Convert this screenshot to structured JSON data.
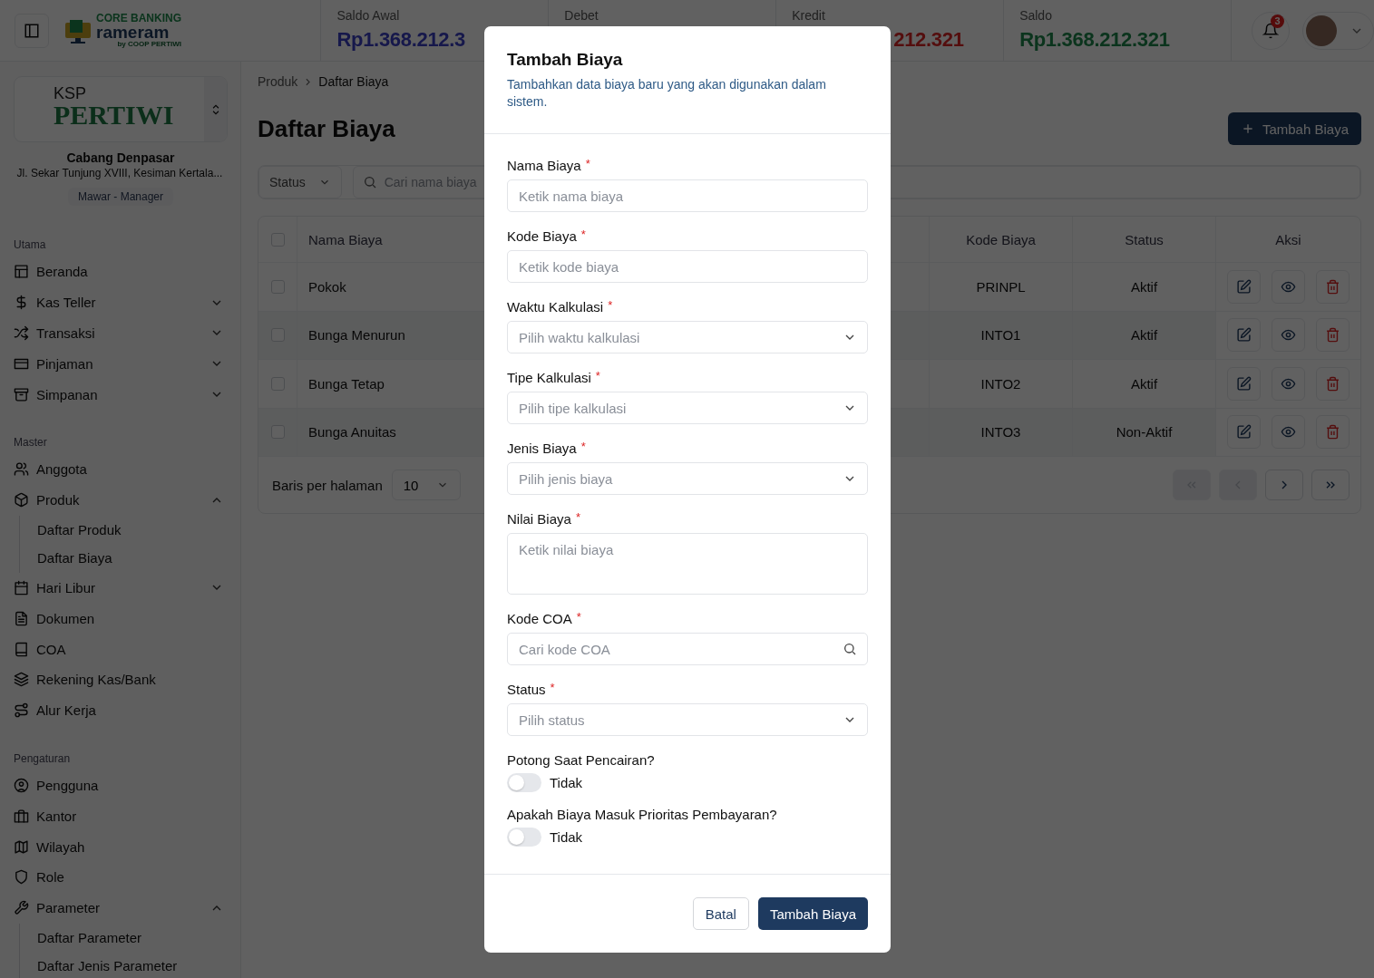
{
  "header": {
    "logo": {
      "line1": "CORE BANKING",
      "line2": "rameram",
      "line3": "by COOP PERTIWI"
    },
    "stats": [
      {
        "label": "Saldo Awal",
        "value": "Rp1.368.212.3",
        "kind": "opening"
      },
      {
        "label": "Debet",
        "kind": "debit"
      },
      {
        "label": "Kredit",
        "value": "212.321",
        "kind": "credit"
      },
      {
        "label": "Saldo",
        "value": "Rp1.368.212.321",
        "kind": "balance"
      }
    ],
    "notification_count": "3"
  },
  "sidebar": {
    "org": {
      "logo_top": "KSP",
      "logo_main": "PERTIWI",
      "branch": "Cabang Denpasar",
      "address": "Jl. Sekar Tunjung XVIII, Kesiman Kertala...",
      "user": "Mawar - Manager"
    },
    "sections": [
      {
        "title": "Utama",
        "items": [
          {
            "label": "Beranda"
          },
          {
            "label": "Kas Teller",
            "expanded": false
          },
          {
            "label": "Transaksi",
            "expanded": false
          },
          {
            "label": "Pinjaman",
            "expanded": false
          },
          {
            "label": "Simpanan",
            "expanded": false
          }
        ]
      },
      {
        "title": "Master",
        "items": [
          {
            "label": "Anggota"
          },
          {
            "label": "Produk",
            "expanded": true,
            "children": [
              {
                "label": "Daftar Produk"
              },
              {
                "label": "Daftar Biaya"
              }
            ]
          },
          {
            "label": "Hari Libur",
            "expanded": false
          },
          {
            "label": "Dokumen"
          },
          {
            "label": "COA"
          },
          {
            "label": "Rekening Kas/Bank"
          },
          {
            "label": "Alur Kerja"
          }
        ]
      },
      {
        "title": "Pengaturan",
        "items": [
          {
            "label": "Pengguna"
          },
          {
            "label": "Kantor"
          },
          {
            "label": "Wilayah"
          },
          {
            "label": "Role"
          },
          {
            "label": "Parameter",
            "expanded": true,
            "children": [
              {
                "label": "Daftar Parameter"
              },
              {
                "label": "Daftar Jenis Parameter"
              }
            ]
          }
        ]
      }
    ]
  },
  "breadcrumb": [
    "Produk",
    "Daftar Biaya"
  ],
  "page_title": "Daftar Biaya",
  "add_button": "Tambah Biaya",
  "filters": {
    "status": "Status",
    "search_placeholder": "Cari nama biaya"
  },
  "table": {
    "columns": [
      "Nama Biaya",
      "Kode Biaya",
      "Status",
      "Aksi"
    ],
    "all_checked": false,
    "rows": [
      {
        "name": "Pokok",
        "code": "PRINPL",
        "status": "Aktif",
        "checked": false
      },
      {
        "name": "Bunga Menurun",
        "code": "INTO1",
        "status": "Aktif",
        "checked": false
      },
      {
        "name": "Bunga Tetap",
        "code": "INTO2",
        "status": "Aktif",
        "checked": false
      },
      {
        "name": "Bunga Anuitas",
        "code": "INTO3",
        "status": "Non-Aktif",
        "checked": false
      }
    ]
  },
  "pagination": {
    "rows_label": "Baris per halaman",
    "rows_value": "10",
    "buttons": [
      {
        "kind": "first",
        "disabled": true
      },
      {
        "kind": "prev",
        "disabled": true
      },
      {
        "kind": "next",
        "disabled": false
      },
      {
        "kind": "last",
        "disabled": false
      }
    ]
  },
  "modal": {
    "title": "Tambah Biaya",
    "description": "Tambahkan data biaya baru yang akan digunakan dalam sistem.",
    "fields": [
      {
        "label": "Nama Biaya",
        "required_mark": "*",
        "kind": "text",
        "placeholder": "Ketik nama biaya"
      },
      {
        "label": "Kode Biaya",
        "required_mark": "*",
        "kind": "text",
        "placeholder": "Ketik kode biaya"
      },
      {
        "label": "Waktu Kalkulasi",
        "required_mark": "*",
        "kind": "select",
        "placeholder": "Pilih waktu kalkulasi"
      },
      {
        "label": "Tipe Kalkulasi",
        "required_mark": "*",
        "kind": "select",
        "placeholder": "Pilih tipe kalkulasi"
      },
      {
        "label": "Jenis Biaya",
        "required_mark": "*",
        "kind": "select",
        "placeholder": "Pilih jenis biaya"
      },
      {
        "label": "Nilai Biaya",
        "required_mark": "*",
        "kind": "textarea",
        "placeholder": "Ketik nilai biaya"
      },
      {
        "label": "Kode COA",
        "required_mark": "*",
        "kind": "search",
        "placeholder": "Cari kode COA"
      },
      {
        "label": "Status",
        "required_mark": "*",
        "kind": "select",
        "placeholder": "Pilih status"
      }
    ],
    "toggles": [
      {
        "label": "Potong Saat Pencairan?",
        "on": false,
        "state_text": "Tidak"
      },
      {
        "label": "Apakah Biaya Masuk Prioritas Pembayaran?",
        "on": false,
        "state_text": "Tidak"
      }
    ],
    "cancel": "Batal",
    "submit": "Tambah Biaya"
  }
}
